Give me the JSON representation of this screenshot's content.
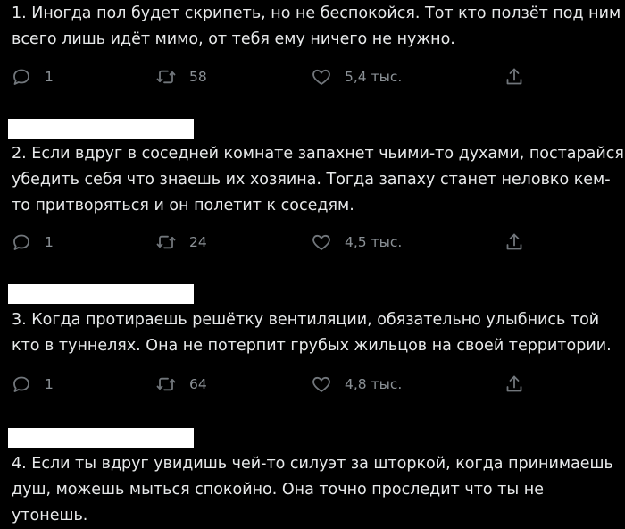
{
  "tweets": [
    {
      "text": "1. Иногда пол будет скрипеть, но не беспокойся. Тот кто ползёт под ним всего лишь идёт мимо, от тебя ему ничего не нужно.",
      "replies": "1",
      "retweets": "58",
      "likes": "5,4 тыс."
    },
    {
      "text": "2. Если вдруг в соседней комнате запахнет чьими-то духами, постарайся убедить себя что знаешь их хозяина. Тогда запаху станет неловко кем-то притворяться и он полетит к соседям.",
      "replies": "1",
      "retweets": "24",
      "likes": "4,5 тыс."
    },
    {
      "text": "3. Когда протираешь решётку вентиляции, обязательно улыбнись той кто в туннелях. Она не потерпит грубых жильцов на своей территории.",
      "replies": "1",
      "retweets": "64",
      "likes": "4,8 тыс."
    },
    {
      "text": "4. Если ты вдруг увидишь чей-то силуэт за шторкой, когда принимаешь душ, можешь мыться спокойно. Она точно проследит что ты не утонешь."
    }
  ],
  "icons": {
    "reply": "reply-icon",
    "retweet": "retweet-icon",
    "like": "heart-icon",
    "share": "share-icon"
  },
  "colors": {
    "background": "#000000",
    "text": "#e7e9ea",
    "icon": "#71767b",
    "redaction": "#ffffff"
  }
}
